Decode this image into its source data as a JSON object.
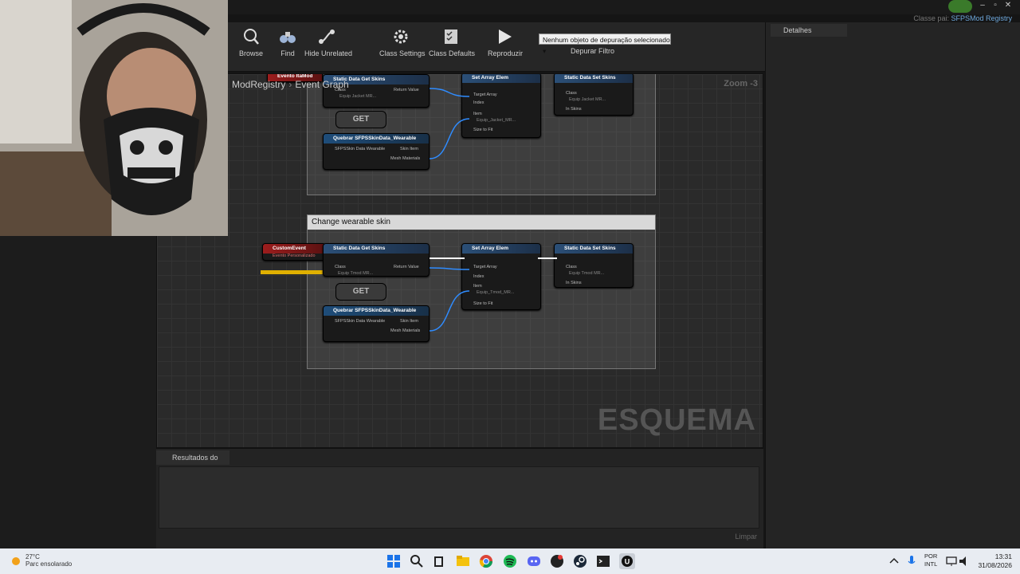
{
  "window": {
    "class_parent_label": "Classe pai:",
    "class_parent_value": "SFPSMod Registry"
  },
  "toolbar": {
    "items": [
      {
        "label": "Browse",
        "icon": "browse-icon"
      },
      {
        "label": "Find",
        "icon": "binoculars-icon"
      },
      {
        "label": "Hide Unrelated",
        "icon": "hide-unrelated-icon"
      },
      {
        "label": "Class Settings",
        "icon": "gear-icon"
      },
      {
        "label": "Class Defaults",
        "icon": "checklist-icon"
      },
      {
        "label": "Reproduzir",
        "icon": "play-icon"
      }
    ],
    "debug_object": "Nenhum objeto de depuração selecionado",
    "debug_filter": "Depurar Filtro"
  },
  "details": {
    "tab_label": "Detalhes"
  },
  "graph": {
    "breadcrumb": [
      "ModRegistry",
      "Event Graph"
    ],
    "zoom": "Zoom -3",
    "watermark": "ESQUEMA",
    "top_group": {
      "event": "Evento ItaMod",
      "get_skins": "Static Data Get Skins",
      "get_skins_class": "Class",
      "get_skins_class_val": "Equip Jacket MR...",
      "return_value": "Return Value",
      "get": "GET",
      "break_wearable": "Quebrar SFPSSkinData_Wearable",
      "skin_data": "SFPSSkin Data Wearable",
      "skin_item": "Skin Item",
      "mesh_materials": "Mesh Materials",
      "set_array": "Set Array Elem",
      "target_array": "Target Array",
      "index": "Index",
      "item": "Item",
      "item_val": "Equip_Jacket_MR...",
      "size_to_fit": "Size to Fit",
      "set_skins": "Static Data Set Skins",
      "set_class": "Class",
      "set_class_val": "Equip Jacket MR...",
      "in_skins": "In Skins"
    },
    "bottom_group": {
      "comment": "Change wearable skin",
      "event": "CustomEvent",
      "event_sub": "Evento Personalizado",
      "get_skins": "Static Data Get Skins",
      "get_skins_class": "Class",
      "get_skins_class_val": "Equip Tmod MR...",
      "return_value": "Return Value",
      "get": "GET",
      "break_wearable": "Quebrar SFPSSkinData_Wearable",
      "skin_data": "SFPSSkin Data Wearable",
      "skin_item": "Skin Item",
      "mesh_materials": "Mesh Materials",
      "set_array": "Set Array Elem",
      "target_array": "Target Array",
      "index": "Index",
      "item": "Item",
      "item_val": "Equip_Tmod_MR...",
      "size_to_fit": "Size to Fit",
      "set_skins": "Static Data Set Skins",
      "set_class": "Class",
      "set_class_val": "Equip Tmod MR...",
      "in_skins": "In Skins"
    }
  },
  "results": {
    "tab_label": "Resultados do Cor",
    "clear": "Limpar"
  },
  "taskbar": {
    "weather_temp": "27°C",
    "weather_desc": "Parc ensolarado",
    "lang_top": "POR",
    "lang_bottom": "INTL",
    "time": "13:31",
    "date": "31/08/2026",
    "apps": [
      "windows-start-icon",
      "search-icon",
      "file-explorer-icon",
      "folder-icon",
      "chrome-icon",
      "spotify-icon",
      "discord-icon",
      "app-icon",
      "steam-icon",
      "terminal-icon",
      "unreal-engine-icon"
    ]
  },
  "colors": {
    "exec_wire": "#ffffff",
    "data_wire": "#2f8cff",
    "event_header": "#9c1d1d",
    "function_header": "#2b4f77"
  }
}
